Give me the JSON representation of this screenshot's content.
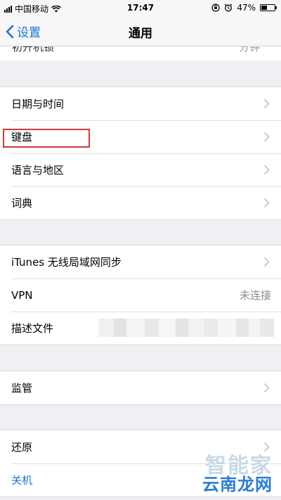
{
  "status_bar": {
    "carrier": "中国移动",
    "time": "17:47",
    "battery": "47%",
    "battery_level": 0.47
  },
  "nav": {
    "back_label": "设置",
    "title": "通用"
  },
  "partial_row": {
    "label": "初开机锁",
    "value": "分钟"
  },
  "group1": [
    {
      "label": "日期与时间"
    },
    {
      "label": "键盘"
    },
    {
      "label": "语言与地区"
    },
    {
      "label": "词典"
    }
  ],
  "group2": [
    {
      "label": "iTunes 无线局域网同步",
      "value": ""
    },
    {
      "label": "VPN",
      "value": "未连接"
    },
    {
      "label": "描述文件",
      "value": ""
    }
  ],
  "group3": [
    {
      "label": "监管"
    }
  ],
  "group4": [
    {
      "label": "还原"
    },
    {
      "label": "关机"
    }
  ],
  "watermark": {
    "line1": "智能家",
    "line2": "云南龙网"
  },
  "colors": {
    "accent": "#1a73d9",
    "highlight": "#d23a3a",
    "background": "#efeff4"
  }
}
